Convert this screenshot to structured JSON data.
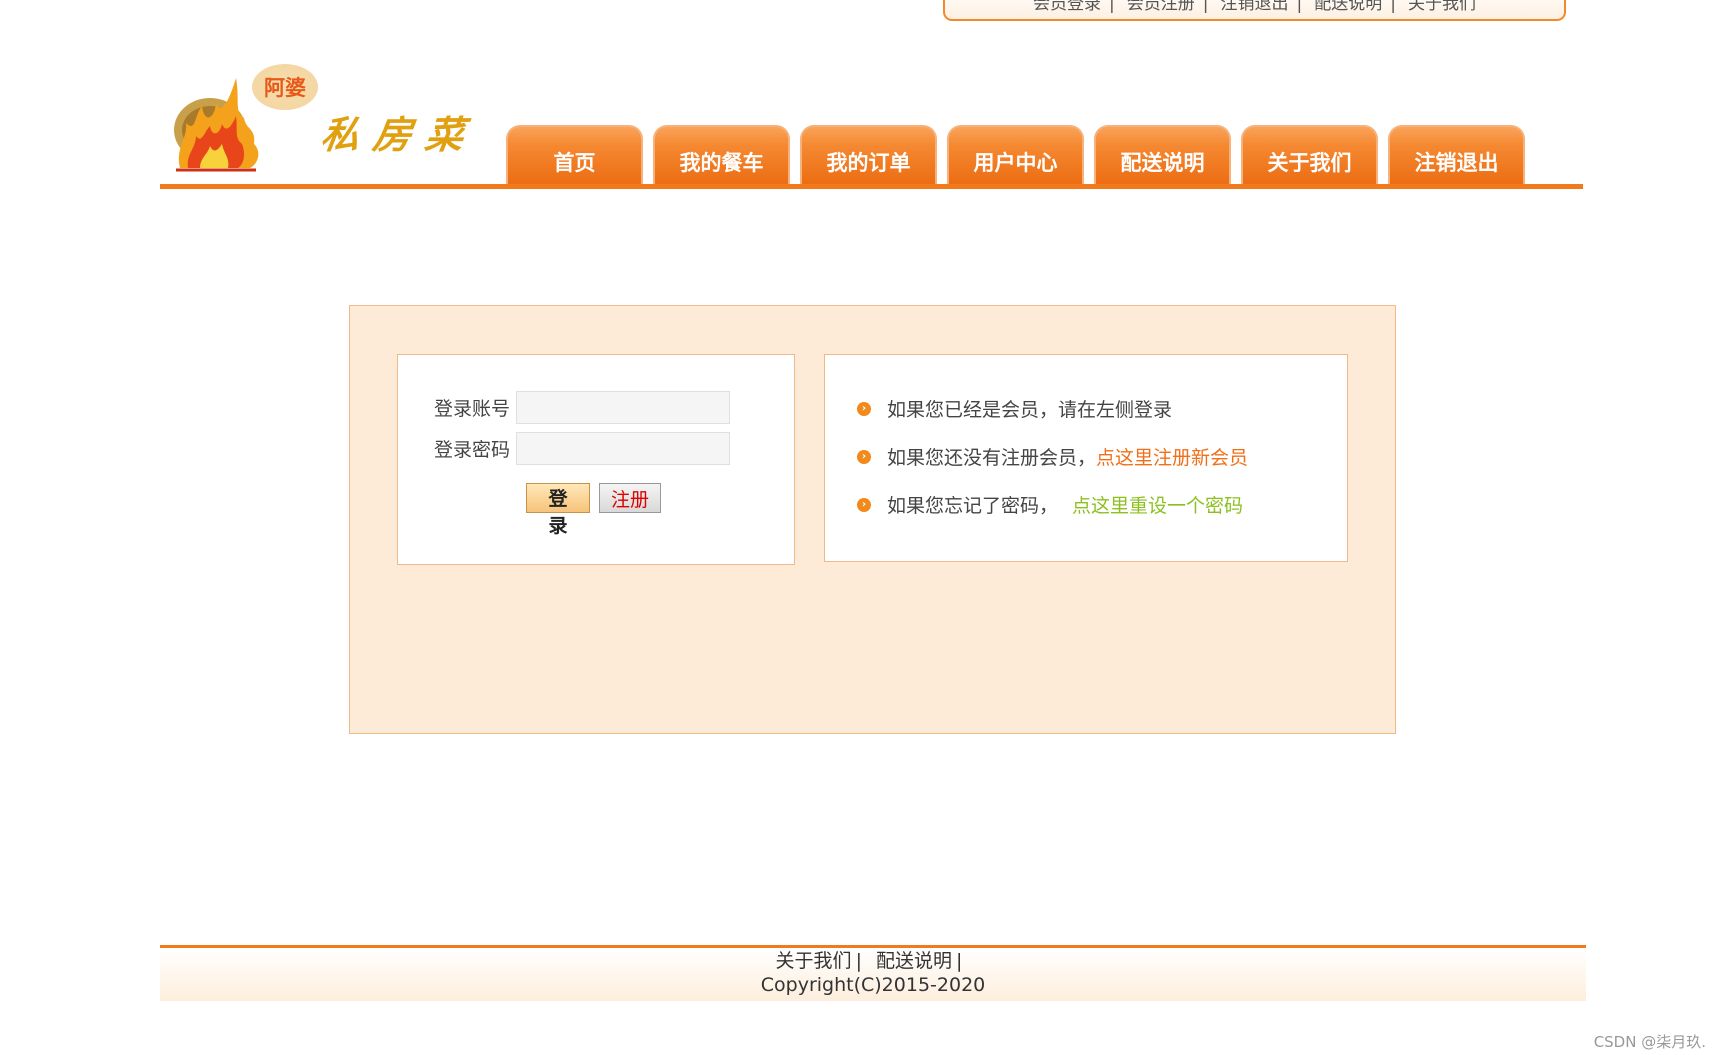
{
  "topbar": {
    "links": [
      "会员登录",
      "会员注册",
      "注销退出",
      "配送说明",
      "关于我们"
    ]
  },
  "logo": {
    "badge": "阿婆",
    "script": "私房菜"
  },
  "nav": {
    "tabs": [
      "首页",
      "我的餐车",
      "我的订单",
      "用户中心",
      "配送说明",
      "关于我们",
      "注销退出"
    ]
  },
  "login": {
    "account_label": "登录账号",
    "password_label": "登录密码",
    "account_value": "",
    "password_value": "",
    "login_button": "登 录",
    "register_button": "注册"
  },
  "info": {
    "line1": "如果您已经是会员，请在左侧登录",
    "line2_text": "如果您还没有注册会员，",
    "line2_link": "点这里注册新会员",
    "line3_text": "如果您忘记了密码，",
    "line3_link": "点这里重设一个密码"
  },
  "footer": {
    "link1": "关于我们",
    "link2": "配送说明",
    "copyright": "Copyright(C)2015-2020"
  },
  "watermark": "CSDN @柒月玖.",
  "colors": {
    "accent": "#f07a1c",
    "panel_bg": "#fdebd8",
    "link_orange": "#f0701a",
    "link_green": "#8cc020"
  }
}
